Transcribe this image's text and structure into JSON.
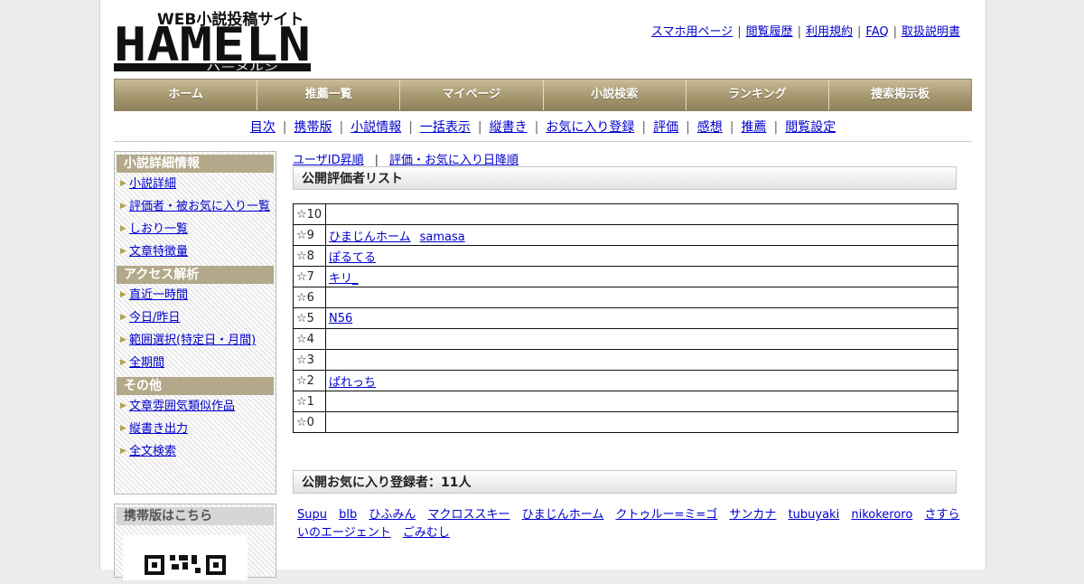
{
  "header": {
    "logo_tagline": "WEB小説投稿サイト",
    "logo_text": "HAMELN",
    "logo_sub": "ハーメルン",
    "top_links": [
      "スマホ用ページ",
      "閲覧履歴",
      "利用規約",
      "FAQ",
      "取扱説明書"
    ]
  },
  "main_nav": [
    "ホーム",
    "推薦一覧",
    "マイページ",
    "小説検索",
    "ランキング",
    "捜索掲示板"
  ],
  "sub_nav": [
    "目次",
    "携帯版",
    "小説情報",
    "一括表示",
    "縦書き",
    "お気に入り登録",
    "評価",
    "感想",
    "推薦",
    "閲覧設定"
  ],
  "sidebar": {
    "sections": [
      {
        "title": "小説詳細情報",
        "items": [
          "小説詳細",
          "評価者・被お気に入り一覧",
          "しおり一覧",
          "文章特徴量"
        ]
      },
      {
        "title": "アクセス解析",
        "items": [
          "直近一時間",
          "今日/昨日",
          "範囲選択(特定日・月間)",
          "全期間"
        ]
      },
      {
        "title": "その他",
        "items": [
          "文章雰囲気類似作品",
          "縦書き出力",
          "全文検索"
        ]
      }
    ],
    "mobile_title": "携帯版はこちら"
  },
  "content": {
    "sort_links": [
      "ユーザID昇順",
      "評価・お気に入り日降順"
    ],
    "sort_sep": "|",
    "rating_title": "公開評価者リスト",
    "ratings": [
      {
        "star": "☆10",
        "names": []
      },
      {
        "star": "☆9",
        "names": [
          "ひまじんホーム",
          "samasa"
        ]
      },
      {
        "star": "☆8",
        "names": [
          "ぽるてる"
        ]
      },
      {
        "star": "☆7",
        "names": [
          "キリ_"
        ]
      },
      {
        "star": "☆6",
        "names": []
      },
      {
        "star": "☆5",
        "names": [
          "N56"
        ]
      },
      {
        "star": "☆4",
        "names": []
      },
      {
        "star": "☆3",
        "names": []
      },
      {
        "star": "☆2",
        "names": [
          "ぱれっち"
        ]
      },
      {
        "star": "☆1",
        "names": []
      },
      {
        "star": "☆0",
        "names": []
      }
    ],
    "favorites_title": "公開お気に入り登録者：11人",
    "favorites": [
      "Supu",
      "blb",
      "ひふみん",
      "マクロススキー",
      "ひまじんホーム",
      "クトゥルー=ミ=ゴ",
      "サンカナ",
      "tubuyaki",
      "nikokeroro",
      "さすらいのエージェント",
      "ごみむし"
    ]
  },
  "colors": {
    "nav_gold": "#a89a72",
    "sidebar_head": "#b3a98a",
    "link": "#0000cc"
  }
}
